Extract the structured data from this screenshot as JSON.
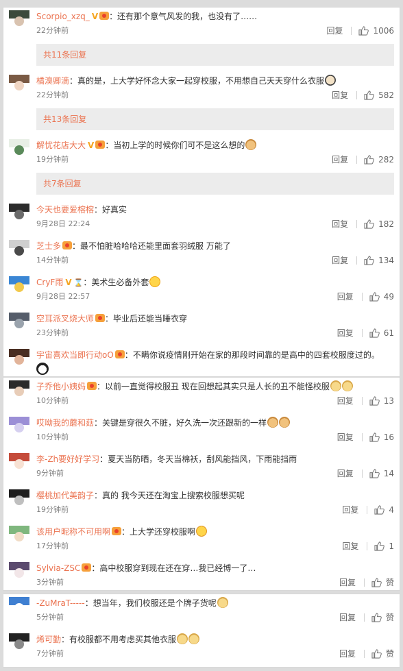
{
  "colors": {
    "username": "#eb7350",
    "timestamp": "#808080",
    "reply_bar_bg": "#ececec",
    "vip": "#f5a623"
  },
  "panel_a": {
    "comments": [
      {
        "username": "Scorpio_xzq_",
        "badges": [
          "vip-icon",
          "medal-icon"
        ],
        "text": "还有那个意气风发的我，也没有了……",
        "time": "22分钟前",
        "reply": "回复",
        "likes": "1006",
        "emoji": []
      },
      {
        "username": "橘溴卿滴",
        "badges": [],
        "text": "真的是，上大学好怀念大家一起穿校服，不用想自己天天穿什么衣服",
        "time": "22分钟前",
        "reply": "回复",
        "likes": "582",
        "emoji": [
          "facepalm"
        ]
      },
      {
        "username": "解忧花店大大",
        "badges": [
          "vip-icon",
          "medal-icon"
        ],
        "text": "当初上学的时候你们可不是这么想的",
        "time": "19分钟前",
        "reply": "回复",
        "likes": "282",
        "emoji": [
          "cat"
        ]
      },
      {
        "username": "今天也要爱榕榕",
        "badges": [],
        "text": "好真实",
        "time": "9月28日 22:24",
        "reply": "回复",
        "likes": "182",
        "emoji": []
      },
      {
        "username": "芝士多",
        "badges": [
          "medal-icon"
        ],
        "text": "最不怕脏哈哈哈还能里面套羽绒服 万能了",
        "time": "14分钟前",
        "reply": "回复",
        "likes": "134",
        "emoji": []
      },
      {
        "username": "CryF雨",
        "badges": [
          "vip-icon",
          "hourglass-icon"
        ],
        "text": "美术生必备外套",
        "time": "9月28日 22:57",
        "reply": "回复",
        "likes": "49",
        "emoji": [
          "laugh"
        ]
      },
      {
        "username": "空耳派叉烧大师",
        "badges": [
          "medal-icon"
        ],
        "text": "毕业后还能当睡衣穿",
        "time": "23分钟前",
        "reply": "回复",
        "likes": "61",
        "emoji": []
      },
      {
        "username": "宇宙喜欢当即行动oO",
        "badges": [
          "medal-icon"
        ],
        "text": "不瞒你说疫情刚开始在家的那段时间靠的是高中的四套校服度过的。",
        "time": "",
        "reply": "",
        "likes": "",
        "emoji": []
      }
    ],
    "reply_bars": [
      "共11条回复",
      "共13条回复",
      "共7条回复"
    ]
  },
  "panel_b": {
    "comments": [
      {
        "username": "子乔他小姨妈",
        "badges": [
          "medal-icon"
        ],
        "text": "以前一直觉得校服丑 现在回想起其实只是人长的丑不能怪校服",
        "time": "10分钟前",
        "reply": "回复",
        "likes": "13",
        "emoji": [
          "doge",
          "doge"
        ]
      },
      {
        "username": "哎呦我的蘑和菇",
        "badges": [],
        "text": "关键是穿很久不脏，好久洗一次还跟新的一样",
        "time": "10分钟前",
        "reply": "回复",
        "likes": "16",
        "emoji": [
          "cat",
          "cat"
        ]
      },
      {
        "username": "李-Zh要好好学习",
        "badges": [],
        "text": "夏天当防晒，冬天当棉袄，刮风能挡风，下雨能挡雨",
        "time": "9分钟前",
        "reply": "回复",
        "likes": "14",
        "emoji": []
      },
      {
        "username": "樱桃加代美韵子",
        "badges": [],
        "text": "真的 我今天还在淘宝上搜索校服想买呢",
        "time": "19分钟前",
        "reply": "回复",
        "likes": "4",
        "emoji": []
      },
      {
        "username": "该用户昵称不可用啊",
        "badges": [
          "medal-icon"
        ],
        "text": "上大学还穿校服啊",
        "time": "17分钟前",
        "reply": "回复",
        "likes": "1",
        "emoji": [
          "shock"
        ]
      },
      {
        "username": "Sylvia-ZSC",
        "badges": [
          "medal-icon"
        ],
        "text": "高中校服穿到现在还在穿…我已经博一了…",
        "time": "3分钟前",
        "reply": "回复",
        "likes": "赞",
        "emoji": []
      }
    ]
  },
  "panel_c": {
    "comments": [
      {
        "username": "-ZuMraT-----",
        "badges": [],
        "text": "想当年，我们校服还是个牌子货呢",
        "time": "5分钟前",
        "reply": "回复",
        "likes": "赞",
        "emoji": [
          "doge"
        ]
      },
      {
        "username": "烯可勤",
        "badges": [],
        "text": "有校服都不用考虑买其他衣服",
        "time": "7分钟前",
        "reply": "回复",
        "likes": "赞",
        "emoji": [
          "doge",
          "doge"
        ]
      }
    ]
  },
  "misc": {
    "colon": "："
  }
}
